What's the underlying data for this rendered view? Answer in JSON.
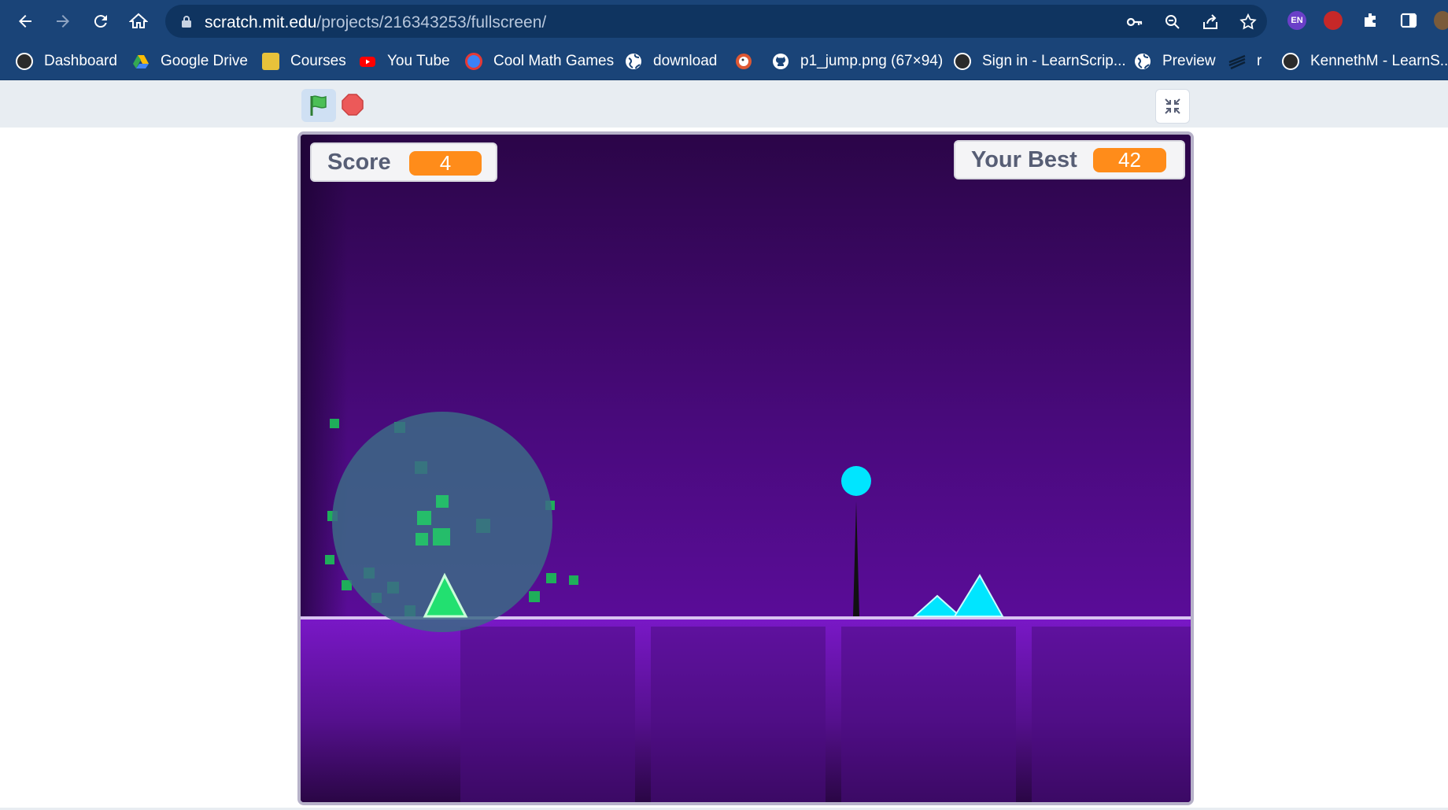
{
  "browser": {
    "url_host": "scratch.mit.edu",
    "url_path": "/projects/216343253/fullscreen/",
    "extensions": {
      "language_badge": "EN"
    }
  },
  "bookmarks": [
    {
      "label": "Dashboard",
      "icon": "avatar-icon",
      "color": "#2b2b2b"
    },
    {
      "label": "Google Drive",
      "icon": "google-drive-icon",
      "color": "#34a853"
    },
    {
      "label": "Courses",
      "icon": "courses-icon",
      "color": "#e8c23a"
    },
    {
      "label": "You Tube",
      "icon": "youtube-icon",
      "color": "#ff0000"
    },
    {
      "label": "Cool Math Games",
      "icon": "coolmath-icon",
      "color": "#3b82f6"
    },
    {
      "label": "download",
      "icon": "globe-icon",
      "color": "#ffffff"
    },
    {
      "label": "",
      "icon": "duckduckgo-icon",
      "color": "#de5833"
    },
    {
      "label": "p1_jump.png (67×94)",
      "icon": "github-icon",
      "color": "#ffffff"
    },
    {
      "label": "Sign in - LearnScrip...",
      "icon": "avatar-icon",
      "color": "#2b2b2b"
    },
    {
      "label": "Preview",
      "icon": "globe-icon",
      "color": "#ffffff"
    },
    {
      "label": "r",
      "icon": "stripes-icon",
      "color": "#333333"
    },
    {
      "label": "KennethM - LearnS...",
      "icon": "avatar-icon",
      "color": "#2b2b2b"
    }
  ],
  "game": {
    "score_label": "Score",
    "score_value": "4",
    "best_label": "Your Best",
    "best_value": "42",
    "colors": {
      "accent": "#ff8c1a",
      "player": "#00e5ff",
      "particles": "#1fae5a"
    }
  }
}
